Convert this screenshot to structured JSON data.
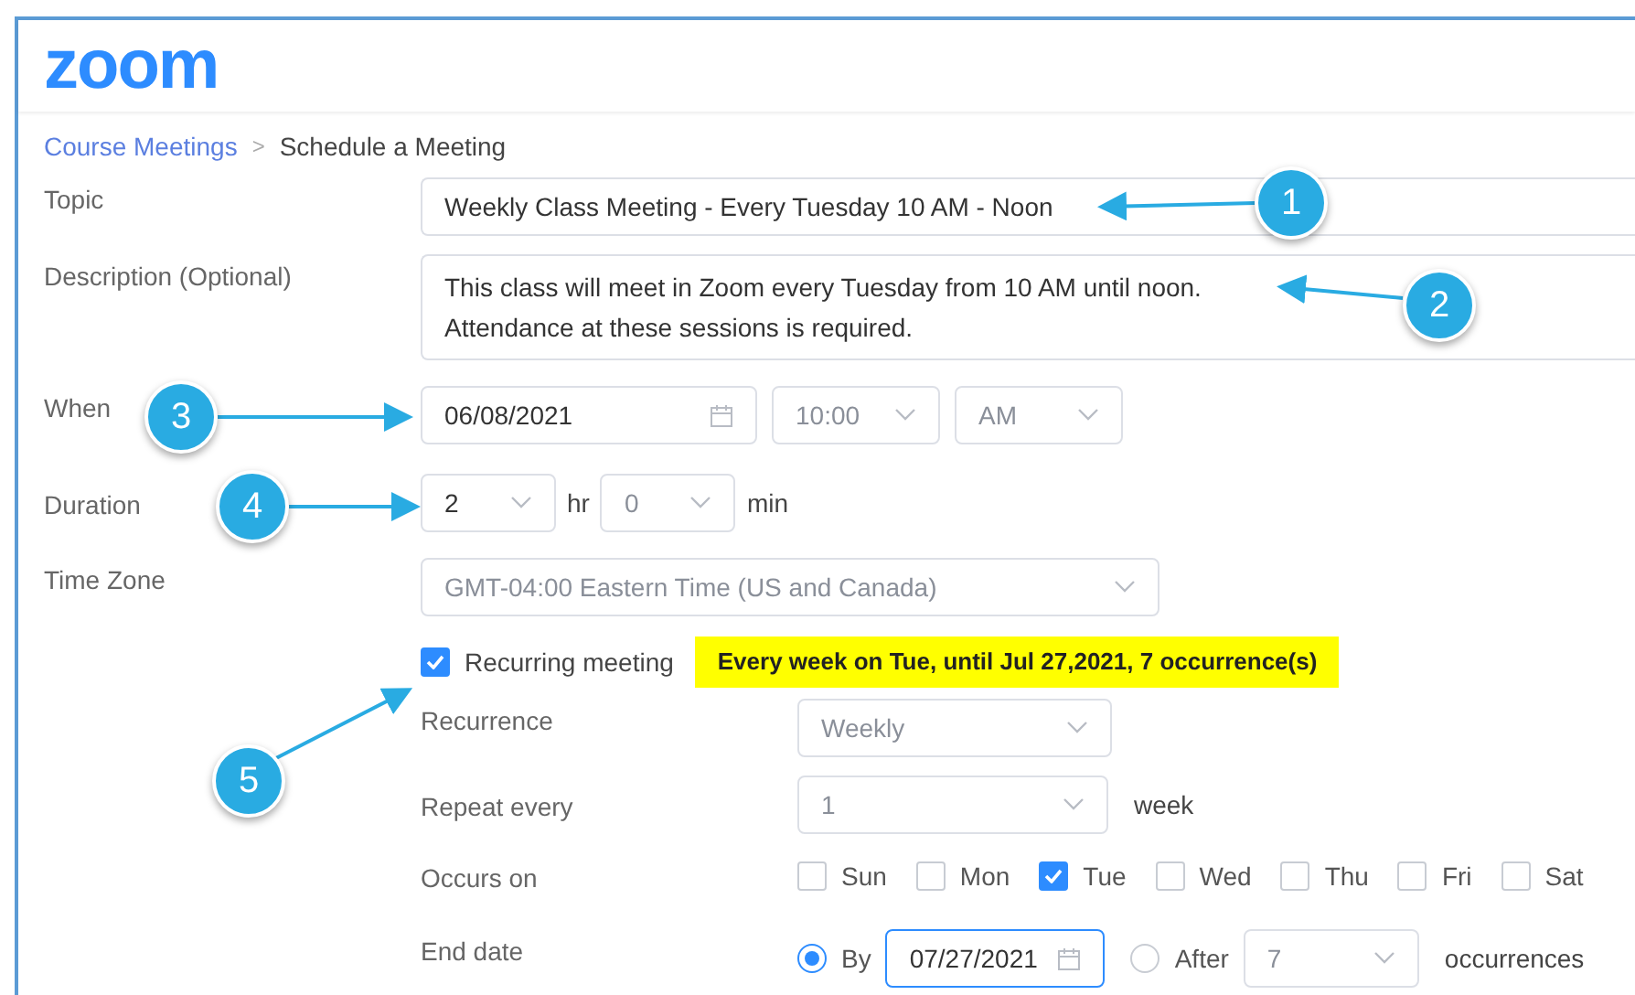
{
  "logo": "zoom",
  "breadcrumb": {
    "link": "Course Meetings",
    "separator": ">",
    "current": "Schedule a Meeting"
  },
  "topic": {
    "label": "Topic",
    "value": "Weekly Class Meeting - Every Tuesday 10 AM - Noon"
  },
  "description": {
    "label": "Description (Optional)",
    "lines": [
      "This class will meet in Zoom every Tuesday from 10 AM until noon.",
      "Attendance at these sessions is required."
    ]
  },
  "when": {
    "label": "When",
    "date": "06/08/2021",
    "time": "10:00",
    "ampm": "AM"
  },
  "duration": {
    "label": "Duration",
    "hours": "2",
    "hours_unit": "hr",
    "minutes": "0",
    "minutes_unit": "min"
  },
  "time_zone": {
    "label": "Time Zone",
    "value": "GMT-04:00 Eastern Time (US and Canada)"
  },
  "recurring": {
    "label": "Recurring meeting",
    "checked": true,
    "summary": "Every week on Tue, until Jul 27,2021, 7 occurrence(s)"
  },
  "recurrence": {
    "label": "Recurrence",
    "value": "Weekly"
  },
  "repeat_every": {
    "label": "Repeat every",
    "value": "1",
    "unit": "week"
  },
  "occurs_on": {
    "label": "Occurs on",
    "days": [
      {
        "label": "Sun",
        "checked": false
      },
      {
        "label": "Mon",
        "checked": false
      },
      {
        "label": "Tue",
        "checked": true
      },
      {
        "label": "Wed",
        "checked": false
      },
      {
        "label": "Thu",
        "checked": false
      },
      {
        "label": "Fri",
        "checked": false
      },
      {
        "label": "Sat",
        "checked": false
      }
    ]
  },
  "end_date": {
    "label": "End date",
    "options": [
      {
        "label": "By",
        "selected": true,
        "kind": "date",
        "value": "07/27/2021"
      },
      {
        "label": "After",
        "selected": false,
        "kind": "count",
        "value": "7",
        "unit": "occurrences"
      }
    ]
  },
  "callouts": [
    "1",
    "2",
    "3",
    "4",
    "5"
  ]
}
